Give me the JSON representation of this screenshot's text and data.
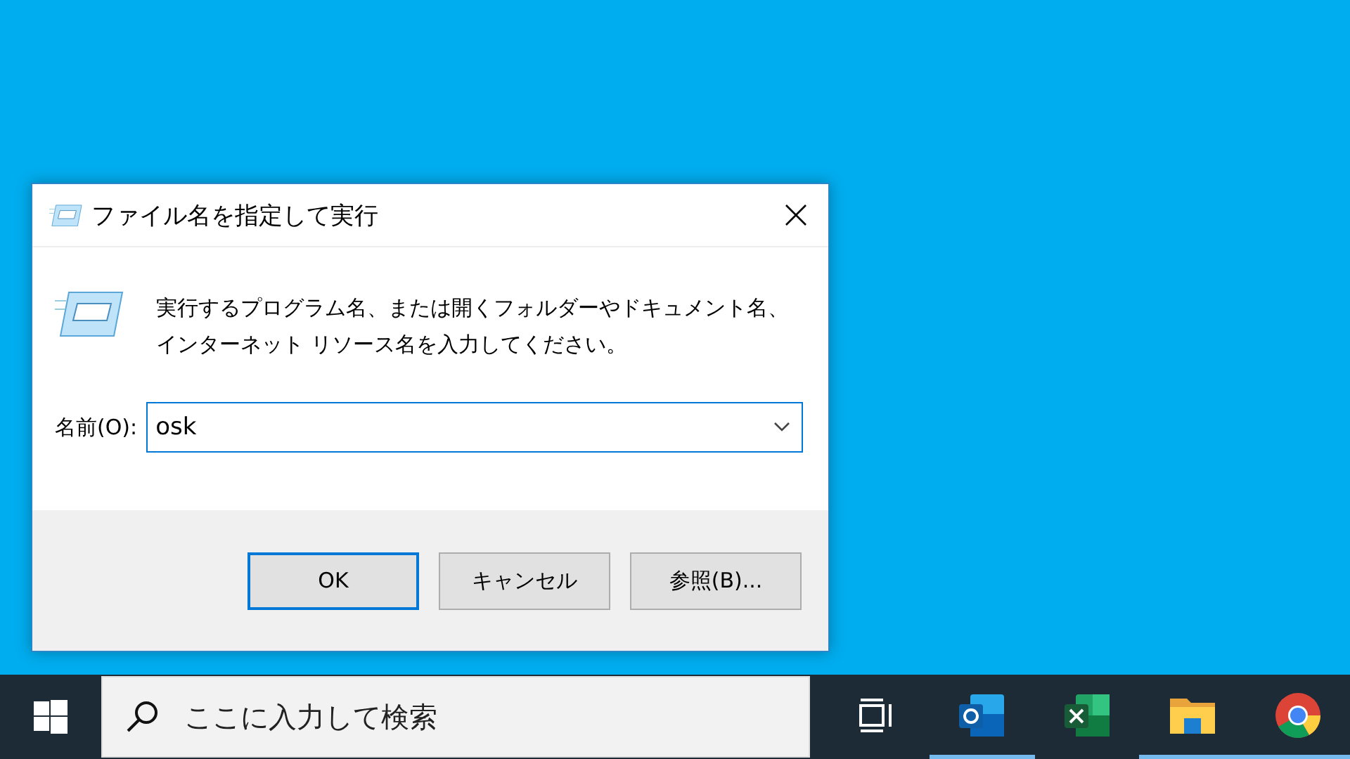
{
  "dialog": {
    "title": "ファイル名を指定して実行",
    "message": "実行するプログラム名、または開くフォルダーやドキュメント名、インターネット リソース名を入力してください。",
    "field_label": "名前(O):",
    "field_value": "osk",
    "buttons": [
      {
        "label": "OK",
        "selected": true
      },
      {
        "label": "キャンセル",
        "selected": false
      },
      {
        "label": "参照(B)...",
        "selected": false
      }
    ]
  },
  "taskbar": {
    "search": {
      "placeholder": "ここに入力して検索"
    },
    "apps": [
      {
        "kind": "taskview",
        "running": false
      },
      {
        "kind": "mail",
        "running": true
      },
      {
        "kind": "sheet",
        "running": false
      },
      {
        "kind": "folder",
        "running": true
      },
      {
        "kind": "browser",
        "running": true
      }
    ]
  }
}
